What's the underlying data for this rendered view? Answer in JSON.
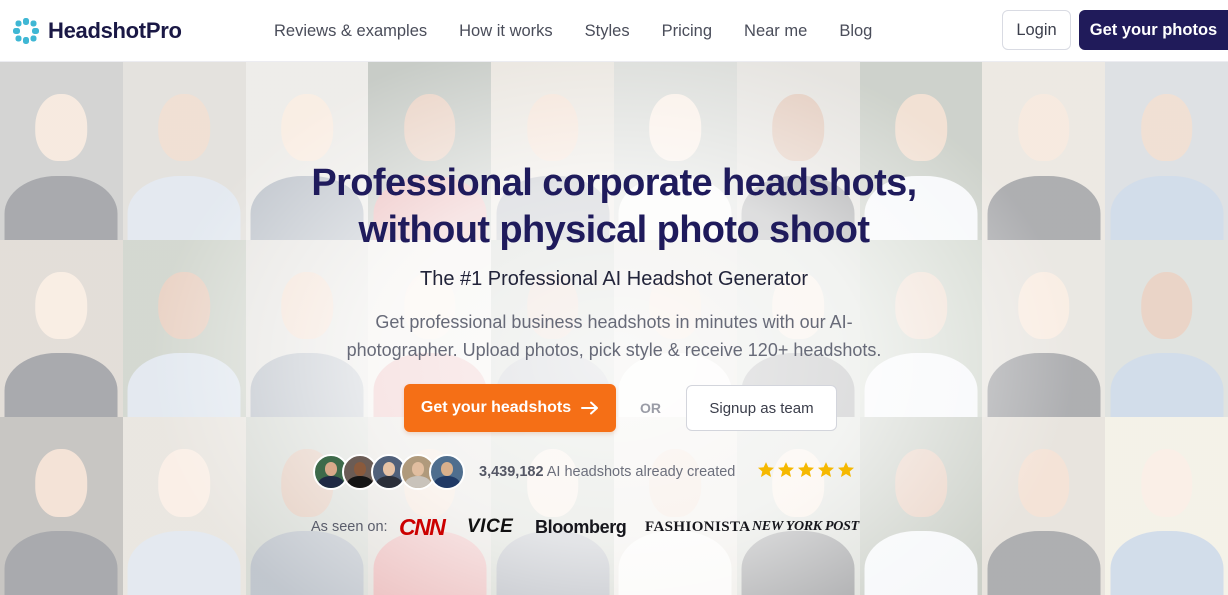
{
  "header": {
    "logo_text": "HeadshotPro",
    "nav": [
      {
        "label": "Reviews & examples"
      },
      {
        "label": "How it works"
      },
      {
        "label": "Styles"
      },
      {
        "label": "Pricing"
      },
      {
        "label": "Near me"
      },
      {
        "label": "Blog"
      }
    ],
    "login_label": "Login",
    "get_photos_label": "Get your photos"
  },
  "hero": {
    "title_line1": "Professional corporate headshots,",
    "title_line2": "without physical photo shoot",
    "subtitle": "The #1 Professional AI Headshot Generator",
    "description_line1": "Get professional business headshots in minutes with our AI-",
    "description_line2": "photographer. Upload photos, pick style & receive 120+ headshots.",
    "cta_label": "Get your headshots",
    "or_label": "OR",
    "team_label": "Signup as team"
  },
  "social_proof": {
    "count": "3,439,182",
    "count_suffix": "AI headshots already created",
    "rating_stars": 5
  },
  "press": {
    "label": "As seen on:",
    "logos": [
      "CNN",
      "VICE",
      "Bloomberg",
      "FASHIONISTA",
      "NEW YORK POST"
    ]
  },
  "colors": {
    "brand_dark": "#201b5a",
    "title": "#1f1b5c",
    "cta_orange": "#f56f16",
    "star": "#f5b800",
    "logo_teal": "#3fb7d4"
  }
}
